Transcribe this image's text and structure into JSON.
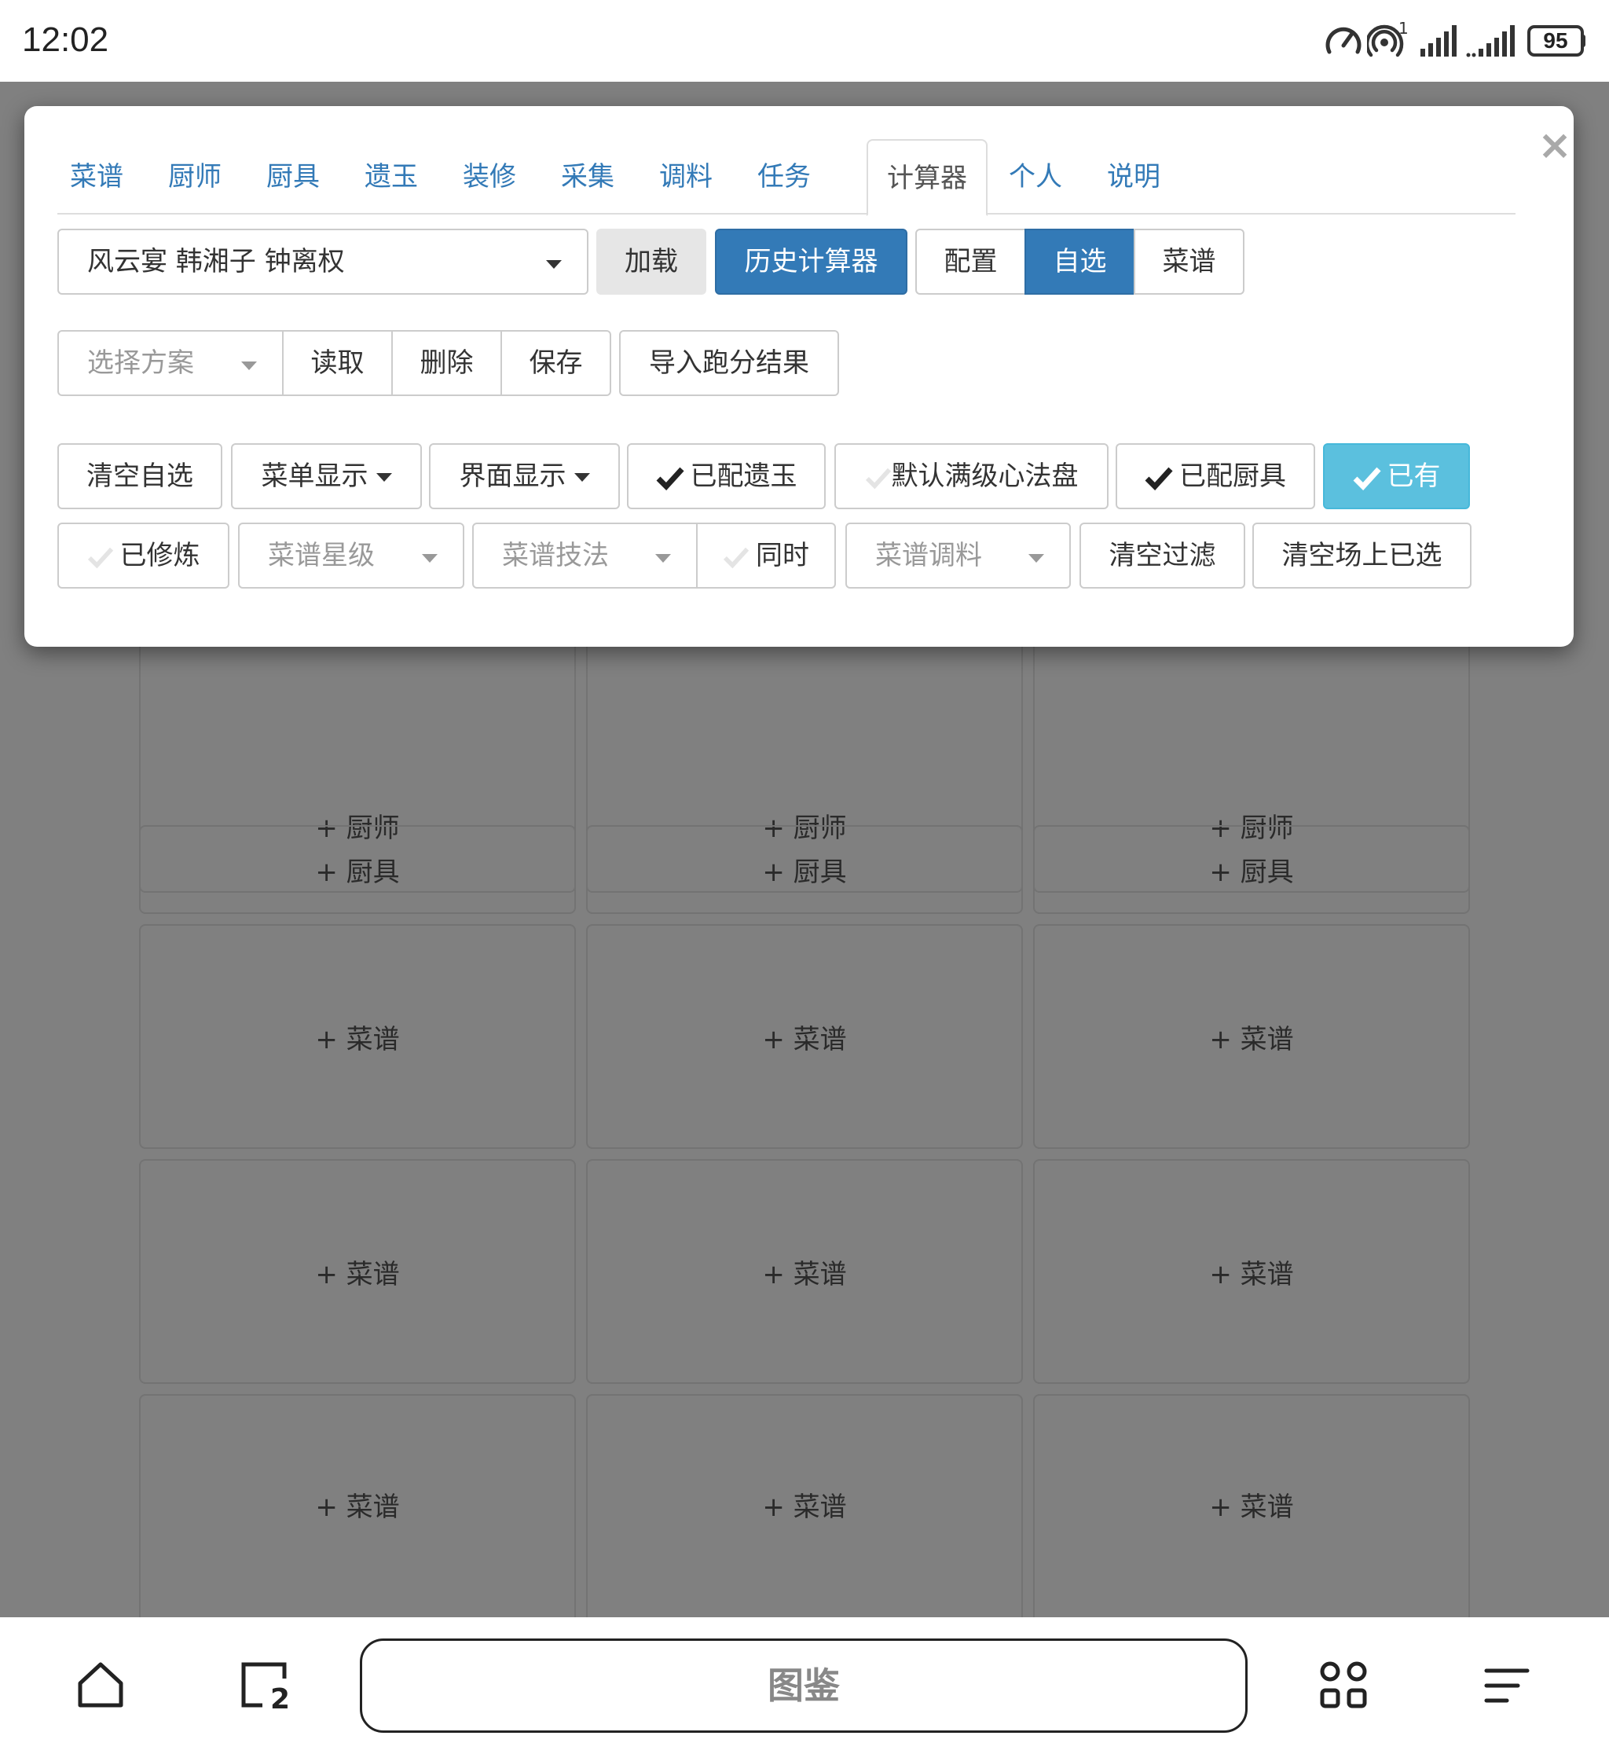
{
  "status_bar": {
    "time": "12:02",
    "battery": "95",
    "hotspot_badge": "1",
    "icons": [
      "speedometer-icon",
      "hotspot-icon",
      "signal-icon",
      "signal-icon"
    ]
  },
  "modal": {
    "close_label": "×",
    "tabs": [
      {
        "label": "菜谱"
      },
      {
        "label": "厨师"
      },
      {
        "label": "厨具"
      },
      {
        "label": "遗玉"
      },
      {
        "label": "装修"
      },
      {
        "label": "采集"
      },
      {
        "label": "调料"
      },
      {
        "label": "任务"
      },
      {
        "label": "计算器",
        "active": true
      },
      {
        "label": "个人"
      },
      {
        "label": "说明"
      }
    ],
    "row1": {
      "rule_select_value": "风云宴 韩湘子 钟离权",
      "load": "加载",
      "history": "历史计算器",
      "mode_config": "配置",
      "mode_custom": "自选",
      "mode_recipe": "菜谱"
    },
    "row2": {
      "plan_placeholder": "选择方案",
      "read": "读取",
      "delete": "删除",
      "save": "保存",
      "import": "导入跑分结果"
    },
    "row3": {
      "clear_custom": "清空自选",
      "menu_display": "菜单显示",
      "ui_display": "界面显示",
      "equipped_jade": "已配遗玉",
      "default_full_level": "默认满级心法盘",
      "equipped_tools": "已配厨具",
      "owned": "已有"
    },
    "row4": {
      "trained": "已修炼",
      "recipe_stars_placeholder": "菜谱星级",
      "recipe_skill_placeholder": "菜谱技法",
      "simultaneous": "同时",
      "recipe_seasoning_placeholder": "菜谱调料",
      "clear_filter": "清空过滤",
      "clear_field_selected": "清空场上已选"
    }
  },
  "grid": {
    "chef_slot": "+ 厨师",
    "tool_slot": "+ 厨具",
    "recipe_slot": "+ 菜谱"
  },
  "bottom_nav": {
    "search_label": "图鉴",
    "tab_count": "2",
    "icons": [
      "home-icon",
      "tabs-icon",
      "apps-icon",
      "menu-icon"
    ]
  },
  "colors": {
    "primary": "#337ab7",
    "info": "#5bc0de",
    "overlay": "#808080",
    "link": "#337ab7"
  }
}
